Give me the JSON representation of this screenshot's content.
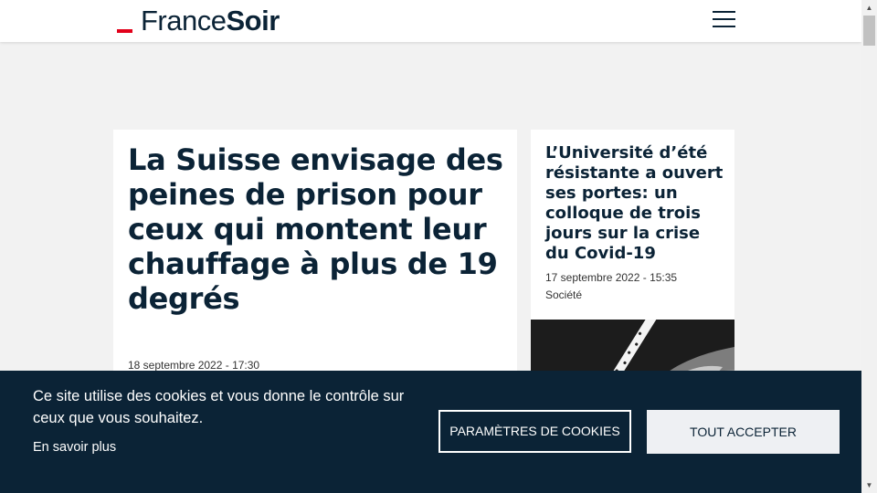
{
  "header": {
    "logo_light": "France",
    "logo_bold": "Soir",
    "menu_icon": "hamburger-menu-icon"
  },
  "articles": {
    "main": {
      "title": "La Suisse envisage des peines de prison pour ceux qui montent leur chauffage à plus de 19 degrés",
      "date": "18 septembre 2022 - 17:30"
    },
    "side": {
      "title": "L’Université d’été résistante a ouvert ses portes: un colloque de trois jours sur la crise du Covid-19",
      "date": "17 septembre 2022 - 15:35",
      "category": "Société"
    }
  },
  "cookie_banner": {
    "text": "Ce site utilise des cookies et vous donne le contrôle sur ceux que vous souhaitez.",
    "learn_more": "En savoir plus",
    "settings_button": "PARAMÈTRES DE COOKIES",
    "accept_button": "TOUT ACCEPTER"
  },
  "colors": {
    "brand_navy": "#0b2336",
    "brand_red": "#e2001a",
    "page_bg": "#f2f2f2"
  }
}
